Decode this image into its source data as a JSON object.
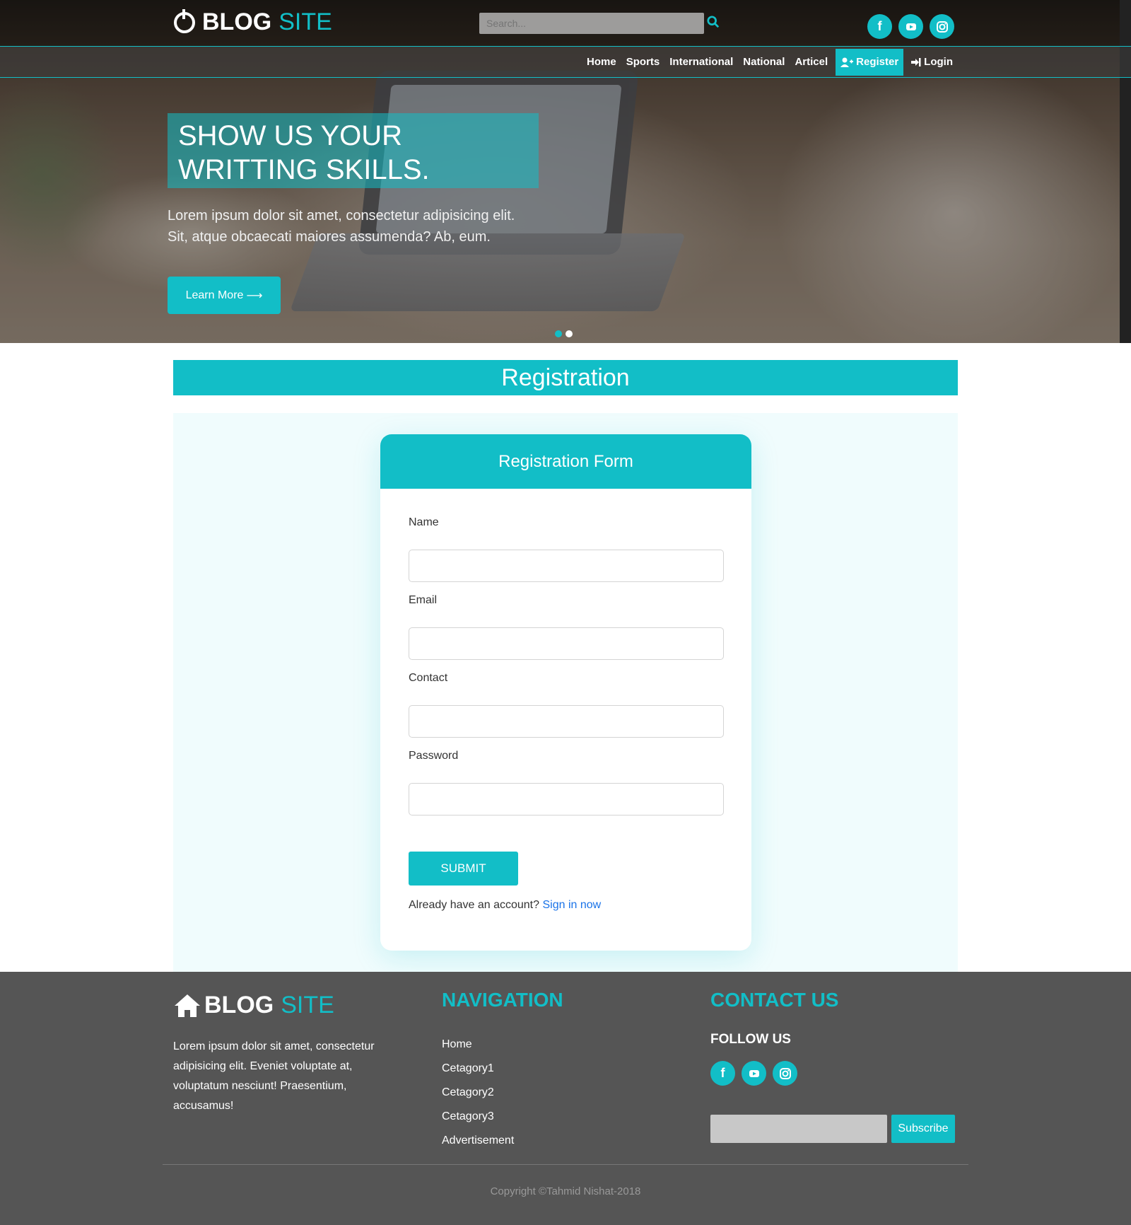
{
  "header": {
    "logo_main": "BLOG",
    "logo_accent": "SITE",
    "search_placeholder": "Search...",
    "social": [
      "facebook-icon",
      "youtube-icon",
      "instagram-icon"
    ]
  },
  "nav": {
    "items": [
      "Home",
      "Sports",
      "International",
      "National",
      "Articel"
    ],
    "register": "Register",
    "login": "Login"
  },
  "hero": {
    "title": "SHOW US YOUR WRITTING SKILLS.",
    "text": "Lorem ipsum dolor sit amet, consectetur adipisicing elit. Sit, atque obcaecati maiores assumenda? Ab, eum.",
    "button": "Learn More"
  },
  "registration": {
    "banner": "Registration",
    "form_title": "Registration Form",
    "fields": [
      {
        "label": "Name",
        "value": ""
      },
      {
        "label": "Email",
        "value": ""
      },
      {
        "label": "Contact",
        "value": ""
      },
      {
        "label": "Password",
        "value": ""
      }
    ],
    "submit": "SUBMIT",
    "account_text": "Already have an account?",
    "signin_link": "Sign in now"
  },
  "footer": {
    "logo_main": "BLOG",
    "logo_accent": "SITE",
    "about": "Lorem ipsum dolor sit amet, consectetur adipisicing elit. Eveniet voluptate at, voluptatum nesciunt! Praesentium, accusamus!",
    "nav_heading": "NAVIGATION",
    "nav_items": [
      "Home",
      "Cetagory1",
      "Cetagory2",
      "Cetagory3",
      "Advertisement"
    ],
    "contact_heading": "CONTACT US",
    "follow": "FOLLOW US",
    "subscribe": "Subscribe",
    "copyright": "Copyright ©Tahmid Nishat-2018"
  },
  "colors": {
    "accent": "#12bec7",
    "footer_bg": "#555555",
    "link": "#1a73e8"
  }
}
